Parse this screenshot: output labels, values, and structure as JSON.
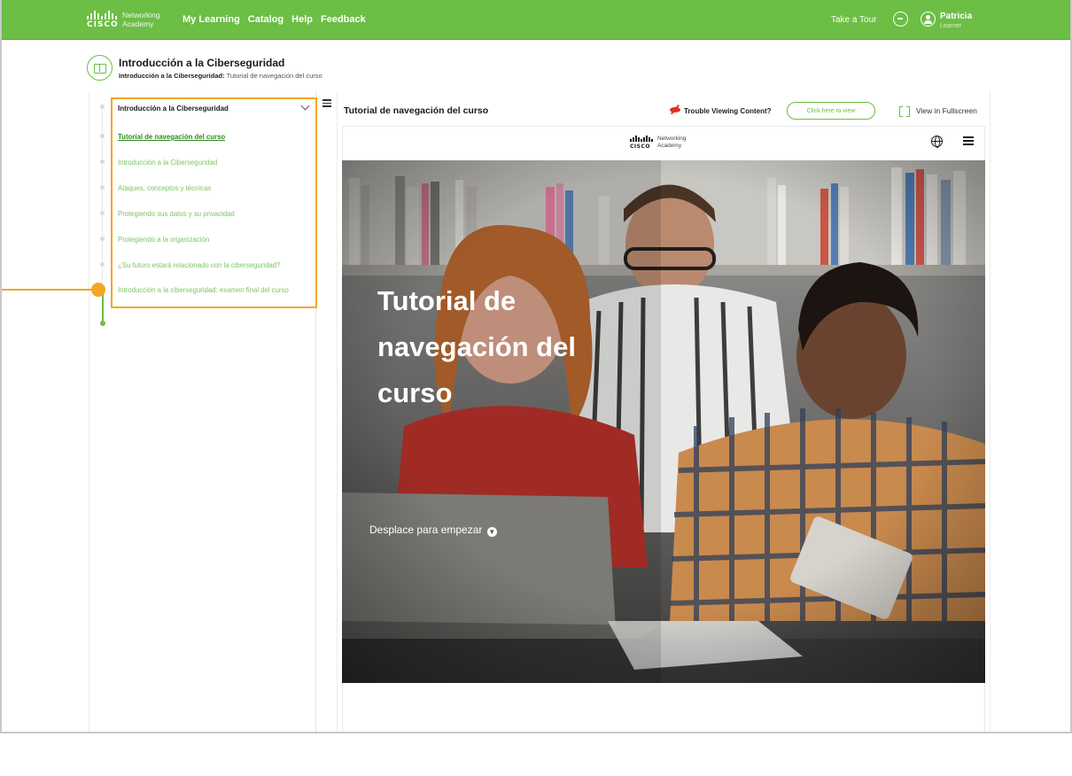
{
  "app": {
    "logo": {
      "brand": "CISCO",
      "line1": "Networking",
      "line2": "Academy"
    },
    "nav": [
      "My Learning",
      "Catalog",
      "Help",
      "Feedback"
    ],
    "take_tour": "Take a Tour",
    "user": {
      "name": "Patricia",
      "role": "Learner"
    },
    "accent_color": "#6cbe45",
    "highlight_color": "#f5a623"
  },
  "course": {
    "title": "Introducción a la Ciberseguridad",
    "breadcrumb_course": "Introducción a la Ciberseguridad:",
    "breadcrumb_page": "Tutorial de navegación del curso"
  },
  "toc": {
    "heading": "Introducción a la Ciberseguridad",
    "items": [
      "Tutorial de navegación del curso",
      "Introducción a la Ciberseguridad",
      "Ataques, conceptos y técnicas",
      "Protegiendo sus datos y su privacidad",
      "Protegiendo a la organización",
      "¿Su futuro estará relacionado con la ciberseguridad?",
      "Introducción a la ciberseguridad: examen final del curso"
    ],
    "active_index": 0
  },
  "content": {
    "title": "Tutorial de navegación del curso",
    "trouble_label": "Trouble Viewing Content?",
    "click_button": "Click here to view",
    "fullscreen_label": "View in Fullscreen",
    "viewer_logo": {
      "brand": "CISCO",
      "line1": "Networking",
      "line2": "Academy"
    },
    "hero_title": "Tutorial de navegación del curso",
    "hero_cta": "Desplace para empezar"
  },
  "icons": [
    "cisco-logo-icon",
    "chat-icon",
    "user-icon",
    "book-icon",
    "menu-icon",
    "chevron-down-icon",
    "trouble-icon",
    "fullscreen-icon",
    "globe-icon",
    "list-icon",
    "arrow-down-circle-icon"
  ]
}
